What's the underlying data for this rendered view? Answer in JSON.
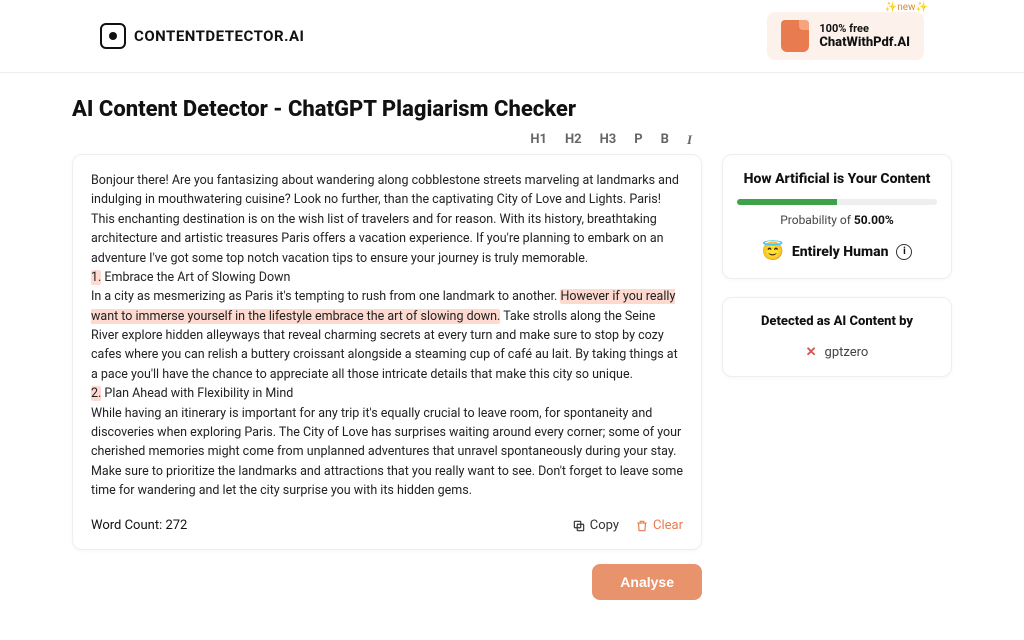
{
  "header": {
    "brand": "CONTENTDETECTOR.AI",
    "promo": {
      "free": "100% free",
      "name": "ChatWithPdf.AI",
      "badge": "✨new✨"
    }
  },
  "page": {
    "title": "AI Content Detector - ChatGPT Plagiarism Checker"
  },
  "toolbar": {
    "h1": "H1",
    "h2": "H2",
    "h3": "H3",
    "p": "P",
    "b": "B",
    "i": "I"
  },
  "editor": {
    "p1": "Bonjour there! Are you fantasizing about wandering along cobblestone streets marveling at landmarks and indulging in mouthwatering cuisine? Look no further, than the captivating City of Love and Lights. Paris! This enchanting destination is on the wish list of travelers and for reason. With its history, breathtaking architecture and artistic treasures Paris offers a vacation experience. If you're planning to embark on an adventure I've got some top notch vacation tips to ensure your journey is truly memorable.",
    "n1": "1.",
    "h1": " Embrace the Art of Slowing Down",
    "p2a": "In a city as mesmerizing as Paris it's tempting to rush from one landmark to another. ",
    "p2hl": "However if you really want to immerse yourself in the lifestyle embrace the art of slowing down.",
    "p2b": " Take strolls along the Seine River explore hidden alleyways that reveal charming secrets at every turn and make sure to stop by cozy cafes where you can relish a buttery croissant alongside a steaming cup of café au lait. By taking things at a pace you'll have the chance to appreciate all those intricate details that make this city so unique.",
    "n2": "2.",
    "h2": " Plan Ahead with Flexibility in Mind",
    "p3": "While having an itinerary is important for any trip it's equally crucial to leave room, for spontaneity and discoveries when exploring Paris. The City of Love has surprises waiting around every corner; some of your cherished memories might come from unplanned adventures that unravel spontaneously during your stay.",
    "p4": "Make sure to prioritize the landmarks and attractions that you really want to see. Don't forget to leave some time for wandering and let the city surprise you with its hidden gems.",
    "word_count_label": "Word Count: 272",
    "copy": "Copy",
    "clear": "Clear"
  },
  "analyse_label": "Analyse",
  "result": {
    "title": "How Artificial is Your Content",
    "probability_prefix": "Probability of ",
    "probability_value": "50.00%",
    "verdict": "Entirely Human",
    "progress_pct": 50
  },
  "detected": {
    "title": "Detected as AI Content by",
    "items": [
      "gptzero"
    ]
  }
}
